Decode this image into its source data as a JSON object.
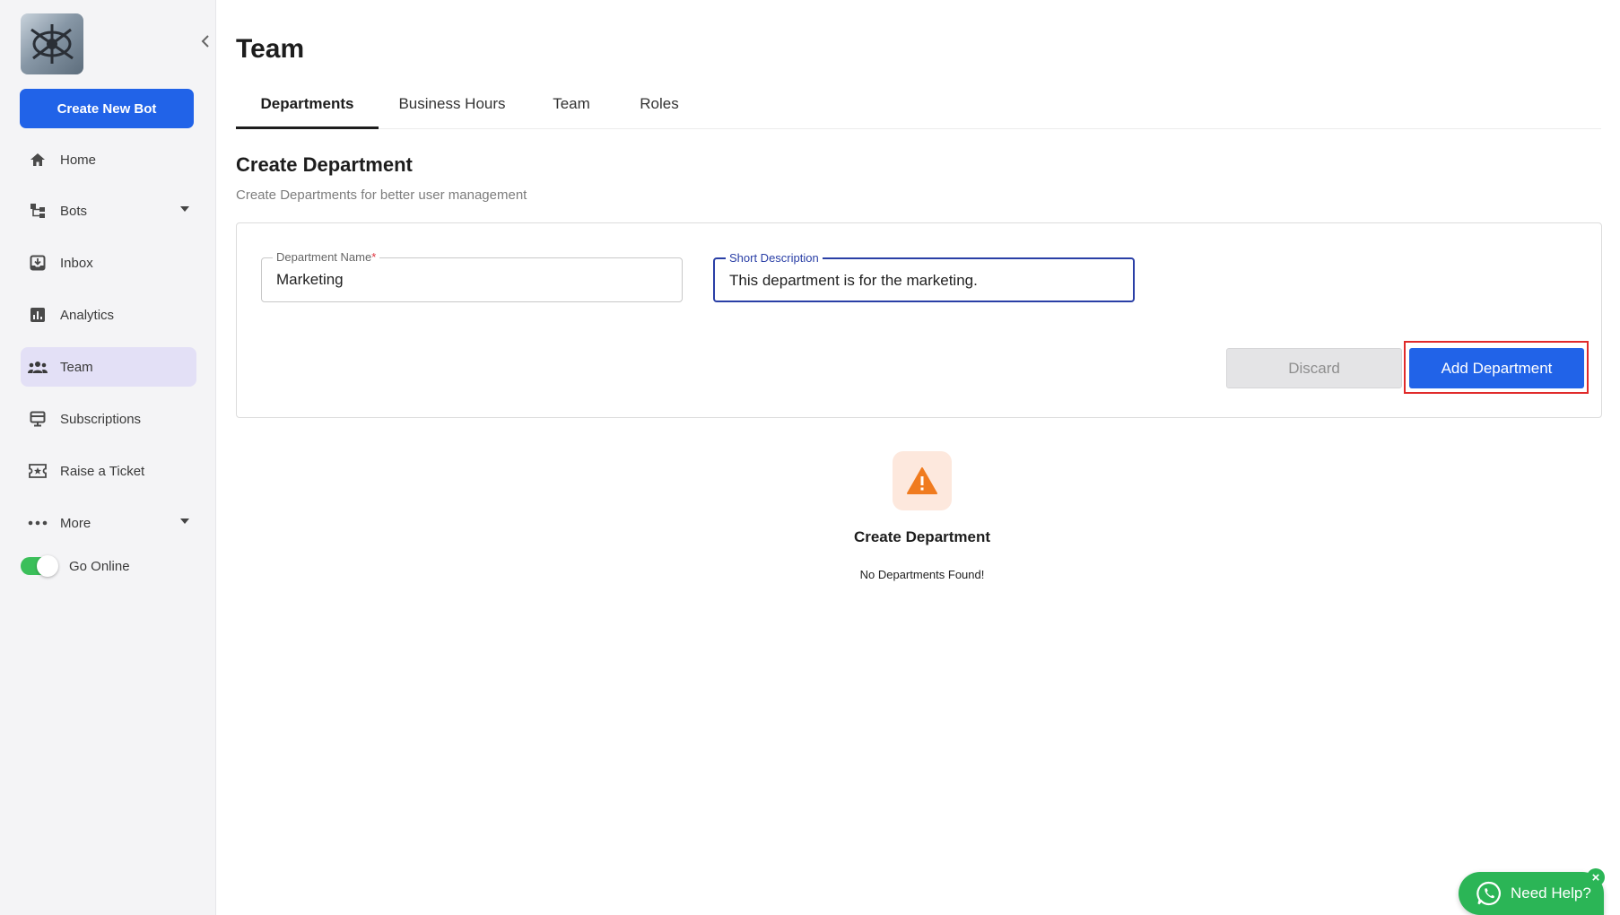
{
  "sidebar": {
    "create_bot_label": "Create New Bot",
    "items": [
      {
        "label": "Home",
        "icon": "home-icon"
      },
      {
        "label": "Bots",
        "icon": "bots-icon"
      },
      {
        "label": "Inbox",
        "icon": "inbox-icon"
      },
      {
        "label": "Analytics",
        "icon": "analytics-icon"
      },
      {
        "label": "Team",
        "icon": "team-icon",
        "active": true
      },
      {
        "label": "Subscriptions",
        "icon": "subscriptions-icon"
      },
      {
        "label": "Raise a Ticket",
        "icon": "ticket-icon"
      },
      {
        "label": "More",
        "icon": "more-icon"
      }
    ],
    "go_online_label": "Go Online",
    "go_online": true
  },
  "header": {
    "title": "Team"
  },
  "tabs": [
    {
      "label": "Departments",
      "active": true
    },
    {
      "label": "Business Hours"
    },
    {
      "label": "Team"
    },
    {
      "label": "Roles"
    }
  ],
  "form": {
    "title": "Create Department",
    "subtitle": "Create Departments for better user management",
    "name_label": "Department Name",
    "name_required_mark": "*",
    "name_value": "Marketing",
    "desc_label": "Short Description",
    "desc_value": "This department is for the marketing.",
    "discard_label": "Discard",
    "add_label": "Add Department"
  },
  "empty_state": {
    "title": "Create Department",
    "message": "No Departments Found!"
  },
  "help_widget": {
    "label": "Need Help?",
    "close_glyph": "×"
  },
  "colors": {
    "primary": "#2163e8",
    "active_nav": "#e3e0f6",
    "warning": "#f07b1f",
    "whatsapp": "#2bb556"
  }
}
